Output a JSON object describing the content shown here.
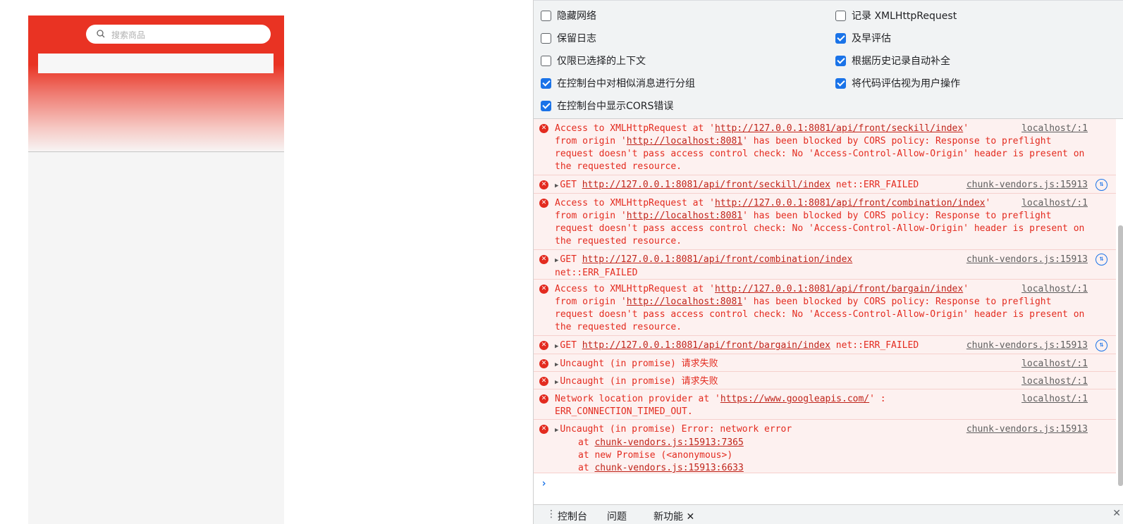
{
  "preview": {
    "search_placeholder": "搜索商品",
    "colors": {
      "header_red": "#e93323",
      "page_bg": "#f5f5f5"
    }
  },
  "devtools": {
    "options": [
      {
        "label": "隐藏网络",
        "checked": false
      },
      {
        "label": "记录 XMLHttpRequest",
        "checked": false
      },
      {
        "label": "保留日志",
        "checked": false
      },
      {
        "label": "及早评估",
        "checked": true
      },
      {
        "label": "仅限已选择的上下文",
        "checked": false
      },
      {
        "label": "根据历史记录自动补全",
        "checked": true
      },
      {
        "label": "在控制台中对相似消息进行分组",
        "checked": true
      },
      {
        "label": "将代码评估视为用户操作",
        "checked": true
      },
      {
        "label": "在控制台中显示CORS错误",
        "checked": true
      }
    ],
    "messages": [
      {
        "src": "localhost/:1",
        "p1": "Access to XMLHttpRequest at '",
        "url": "http://127.0.0.1:8081/api/front/seckill/index",
        "p2": "'",
        "p3": "from origin '",
        "origin": "http://localhost:8081",
        "p4": "' has been blocked by CORS policy: Response to preflight request doesn't pass access control check: No 'Access-Control-Allow-Origin' header is present on the requested resource."
      },
      {
        "src": "chunk-vendors.js:15913",
        "method": "GET",
        "url": "http://127.0.0.1:8081/api/front/seckill/index",
        "status": "net::ERR_FAILED"
      },
      {
        "src": "localhost/:1",
        "p1": "Access to XMLHttpRequest at '",
        "url": "http://127.0.0.1:8081/api/front/combination/index",
        "p2": "'",
        "p3": "from origin '",
        "origin": "http://localhost:8081",
        "p4": "' has been blocked by CORS policy: Response to preflight request doesn't pass access control check: No 'Access-Control-Allow-Origin' header is present on the requested resource."
      },
      {
        "src": "chunk-vendors.js:15913",
        "method": "GET",
        "url": "http://127.0.0.1:8081/api/front/combination/index",
        "status": "net::ERR_FAILED"
      },
      {
        "src": "localhost/:1",
        "p1": "Access to XMLHttpRequest at '",
        "url": "http://127.0.0.1:8081/api/front/bargain/index",
        "p2": "'",
        "p3": "from origin '",
        "origin": "http://localhost:8081",
        "p4": "' has been blocked by CORS policy: Response to preflight request doesn't pass access control check: No 'Access-Control-Allow-Origin' header is present on the requested resource."
      },
      {
        "src": "chunk-vendors.js:15913",
        "method": "GET",
        "url": "http://127.0.0.1:8081/api/front/bargain/index",
        "status": "net::ERR_FAILED"
      },
      {
        "src": "localhost/:1",
        "text": "Uncaught (in promise)",
        "cn": "请求失败"
      },
      {
        "src": "localhost/:1",
        "text": "Uncaught (in promise)",
        "cn": "请求失败"
      },
      {
        "src": "localhost/:1",
        "p1": "Network location provider at '",
        "url": "https://www.googleapis.com/",
        "p2": "' :",
        "p3": "ERR_CONNECTION_TIMED_OUT."
      },
      {
        "src": "chunk-vendors.js:15913",
        "text": "Uncaught (in promise) Error: network error",
        "at": "at",
        "stack1": "chunk-vendors.js:15913:7365",
        "stack2": "at new Promise (<anonymous>)",
        "stack3": "chunk-vendors.js:15913:6633"
      }
    ],
    "prompt": "›",
    "drawer": {
      "tab_console": "控制台",
      "tab_issues": "问题",
      "tab_whatsnew": "新功能"
    }
  }
}
